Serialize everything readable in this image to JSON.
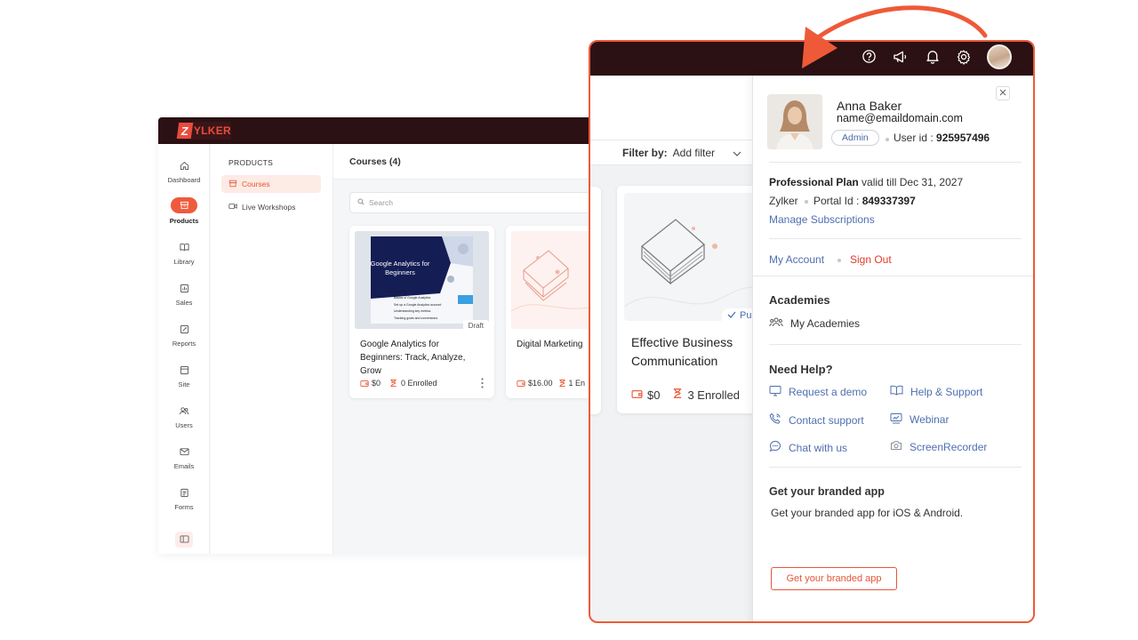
{
  "app": {
    "logo_letter": "Z",
    "logo_text": "YLKER",
    "rail": [
      {
        "label": "Dashboard",
        "icon": "home-icon"
      },
      {
        "label": "Products",
        "icon": "box-icon",
        "active": true
      },
      {
        "label": "Library",
        "icon": "book-icon"
      },
      {
        "label": "Sales",
        "icon": "sales-icon"
      },
      {
        "label": "Reports",
        "icon": "reports-icon"
      },
      {
        "label": "Site",
        "icon": "site-icon"
      },
      {
        "label": "Users",
        "icon": "users-icon"
      },
      {
        "label": "Emails",
        "icon": "mail-icon"
      },
      {
        "label": "Forms",
        "icon": "forms-icon"
      }
    ],
    "subnav": {
      "heading": "PRODUCTS",
      "items": [
        {
          "label": "Courses",
          "active": true
        },
        {
          "label": "Live Workshops"
        }
      ]
    },
    "courses_title": "Courses (4)",
    "search_placeholder": "Search",
    "cards": [
      {
        "title_lines": [
          "Google Analytics for",
          "Beginners: Track, Analyze,",
          "Grow"
        ],
        "status": "Draft",
        "price": "$0",
        "enrolled": "0 Enrolled",
        "thumb_title": "Google Analytics for Beginners",
        "thumb_heading": "Our Service",
        "thumb_list": [
          "Basics of Google Analytics",
          "Set up a Google Analytics account",
          "Understanding key metrics",
          "Tracking goals and conversions"
        ]
      },
      {
        "title_lines": [
          "Digital Marketing"
        ],
        "price": "$16.00",
        "enrolled": "1 En"
      }
    ]
  },
  "zoom": {
    "filter_label": "Filter by:",
    "filter_value": "Add filter",
    "card": {
      "title_lines": [
        "Effective Business",
        "Communication"
      ],
      "status_partial": "Pu",
      "price": "$0",
      "enrolled": "3 Enrolled"
    }
  },
  "profile": {
    "name": "Anna Baker",
    "email": "name@emaildomain.com",
    "role": "Admin",
    "user_id_label": "User id :",
    "user_id": "925957496",
    "plan_name": "Professional Plan",
    "plan_valid": "valid till Dec 31, 2027",
    "org": "Zylker",
    "portal_label": "Portal Id :",
    "portal_id": "849337397",
    "manage_subscriptions": "Manage Subscriptions",
    "my_account": "My Account",
    "sign_out": "Sign Out",
    "academies_title": "Academies",
    "my_academies": "My Academies",
    "help_title": "Need Help?",
    "help": {
      "request_demo": "Request a demo",
      "help_support": "Help & Support",
      "contact_support": "Contact support",
      "webinar": "Webinar",
      "chat": "Chat with us",
      "screen_recorder": "ScreenRecorder"
    },
    "branded_title": "Get your branded app",
    "branded_desc": "Get your branded app for iOS & Android.",
    "branded_button": "Get your branded app"
  },
  "colors": {
    "accent": "#ee5a38",
    "topbar": "#2b1113",
    "link": "#4f6fb0",
    "danger": "#e23b2e"
  }
}
